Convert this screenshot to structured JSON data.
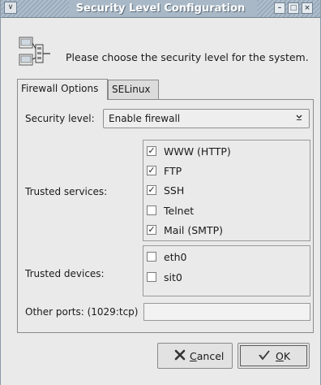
{
  "window": {
    "title": "Security Level Configuration",
    "menu_glyph": "∨",
    "controls": {
      "minimize": "–",
      "maximize": "□",
      "close": "×"
    }
  },
  "header": {
    "text": "Please choose the security level for the system.",
    "icon": "firewall-computers-icon"
  },
  "tabs": [
    {
      "label": "Firewall Options",
      "mnemonic": "F",
      "active": true
    },
    {
      "label": "SELinux",
      "mnemonic": "S",
      "active": false
    }
  ],
  "firewall": {
    "security_level_label": "Security level:",
    "security_level_value": "Enable firewall",
    "trusted_services_label": "Trusted services:",
    "services": [
      {
        "label": "WWW (HTTP)",
        "checked": true
      },
      {
        "label": "FTP",
        "checked": true
      },
      {
        "label": "SSH",
        "checked": true
      },
      {
        "label": "Telnet",
        "checked": false
      },
      {
        "label": "Mail (SMTP)",
        "checked": true
      }
    ],
    "trusted_devices_label": "Trusted devices:",
    "devices": [
      {
        "label": "eth0",
        "checked": false
      },
      {
        "label": "sit0",
        "checked": false
      }
    ],
    "other_ports_label": "Other ports: (1029:tcp)",
    "other_ports_value": ""
  },
  "buttons": {
    "cancel_label": "Cancel",
    "cancel_icon": "cancel-x-icon",
    "ok_label": "OK",
    "ok_icon": "ok-check-icon"
  },
  "colors": {
    "titlebar": "#a9b8c6",
    "title_text": "#ffffff",
    "window_bg": "#eaeaea"
  }
}
